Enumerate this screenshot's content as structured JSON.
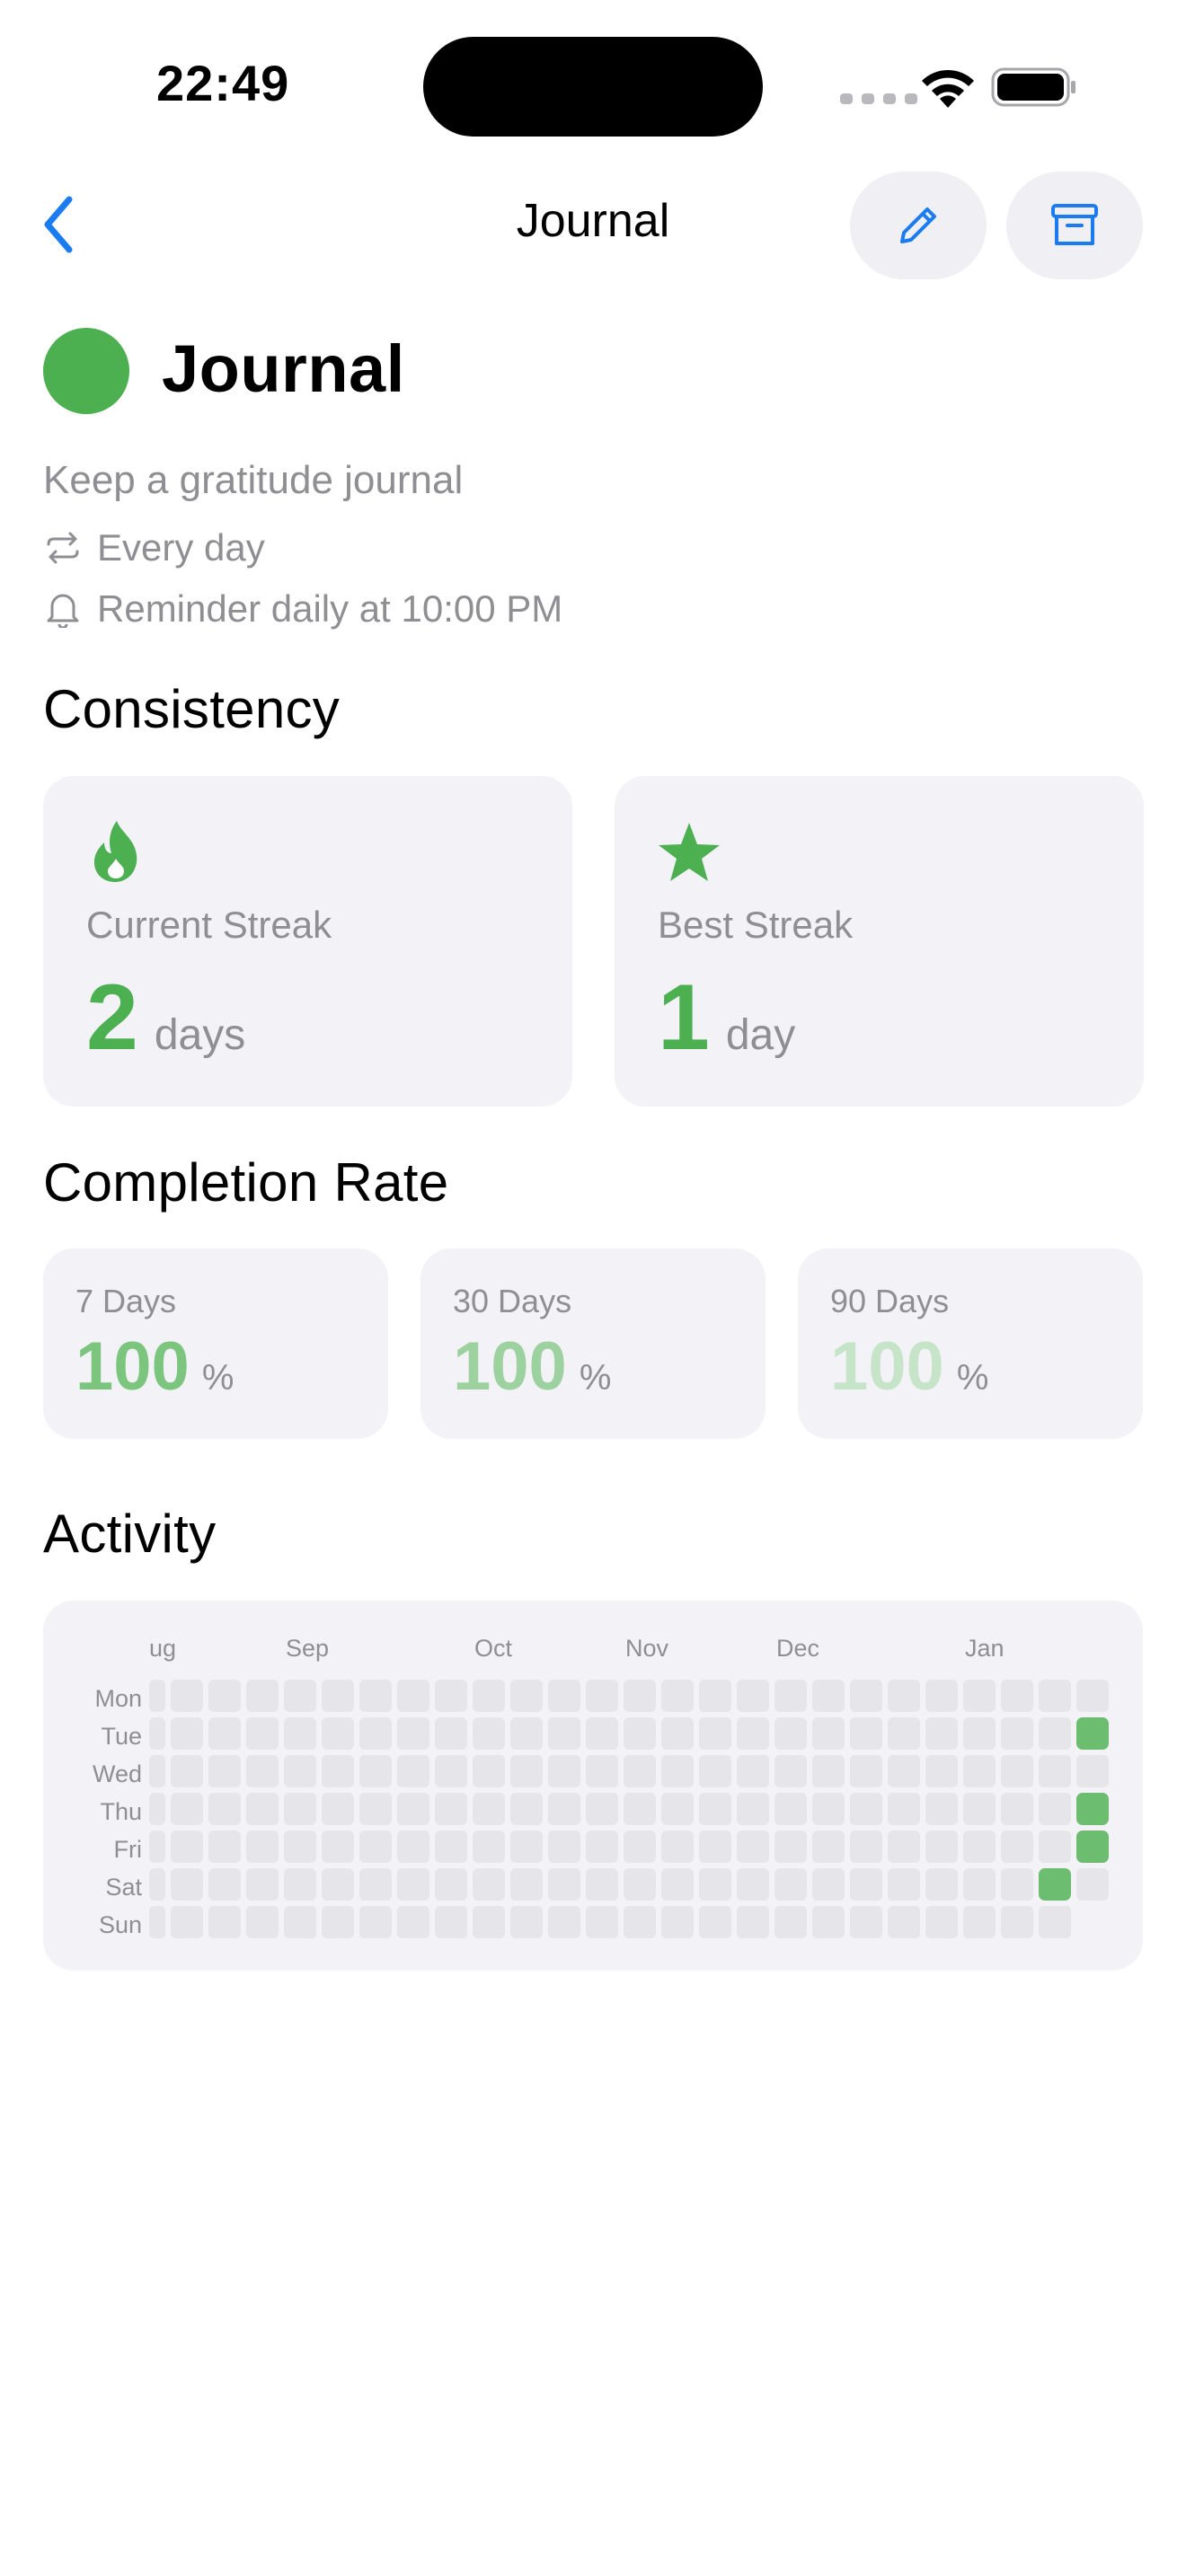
{
  "status_bar": {
    "time": "22:49"
  },
  "nav": {
    "title": "Journal",
    "back_icon": "chevron-left-icon",
    "edit_icon": "pencil-icon",
    "archive_icon": "archive-box-icon",
    "accent_color": "#1a7cf0"
  },
  "habit": {
    "name": "Journal",
    "color": "#4caf50",
    "description": "Keep a gratitude journal",
    "frequency": "Every day",
    "reminder": "Reminder daily at 10:00 PM"
  },
  "consistency": {
    "title": "Consistency",
    "current_streak": {
      "label": "Current Streak",
      "value": "2",
      "unit": "days",
      "icon": "flame-icon"
    },
    "best_streak": {
      "label": "Best Streak",
      "value": "1",
      "unit": "day",
      "icon": "star-icon"
    }
  },
  "completion_rate": {
    "title": "Completion Rate",
    "items": [
      {
        "label": "7 Days",
        "value": "100",
        "unit": "%"
      },
      {
        "label": "30 Days",
        "value": "100",
        "unit": "%"
      },
      {
        "label": "90 Days",
        "value": "100",
        "unit": "%"
      }
    ]
  },
  "activity": {
    "title": "Activity",
    "months": [
      "ug",
      "Sep",
      "Oct",
      "Nov",
      "Dec",
      "Jan"
    ],
    "days": [
      "Mon",
      "Tue",
      "Wed",
      "Thu",
      "Fri",
      "Sat",
      "Sun"
    ],
    "weeks": 26,
    "completed_days": [
      {
        "week": 25,
        "day": "Tue"
      },
      {
        "week": 25,
        "day": "Thu"
      },
      {
        "week": 25,
        "day": "Fri"
      },
      {
        "week": 24,
        "day": "Sat"
      }
    ]
  }
}
